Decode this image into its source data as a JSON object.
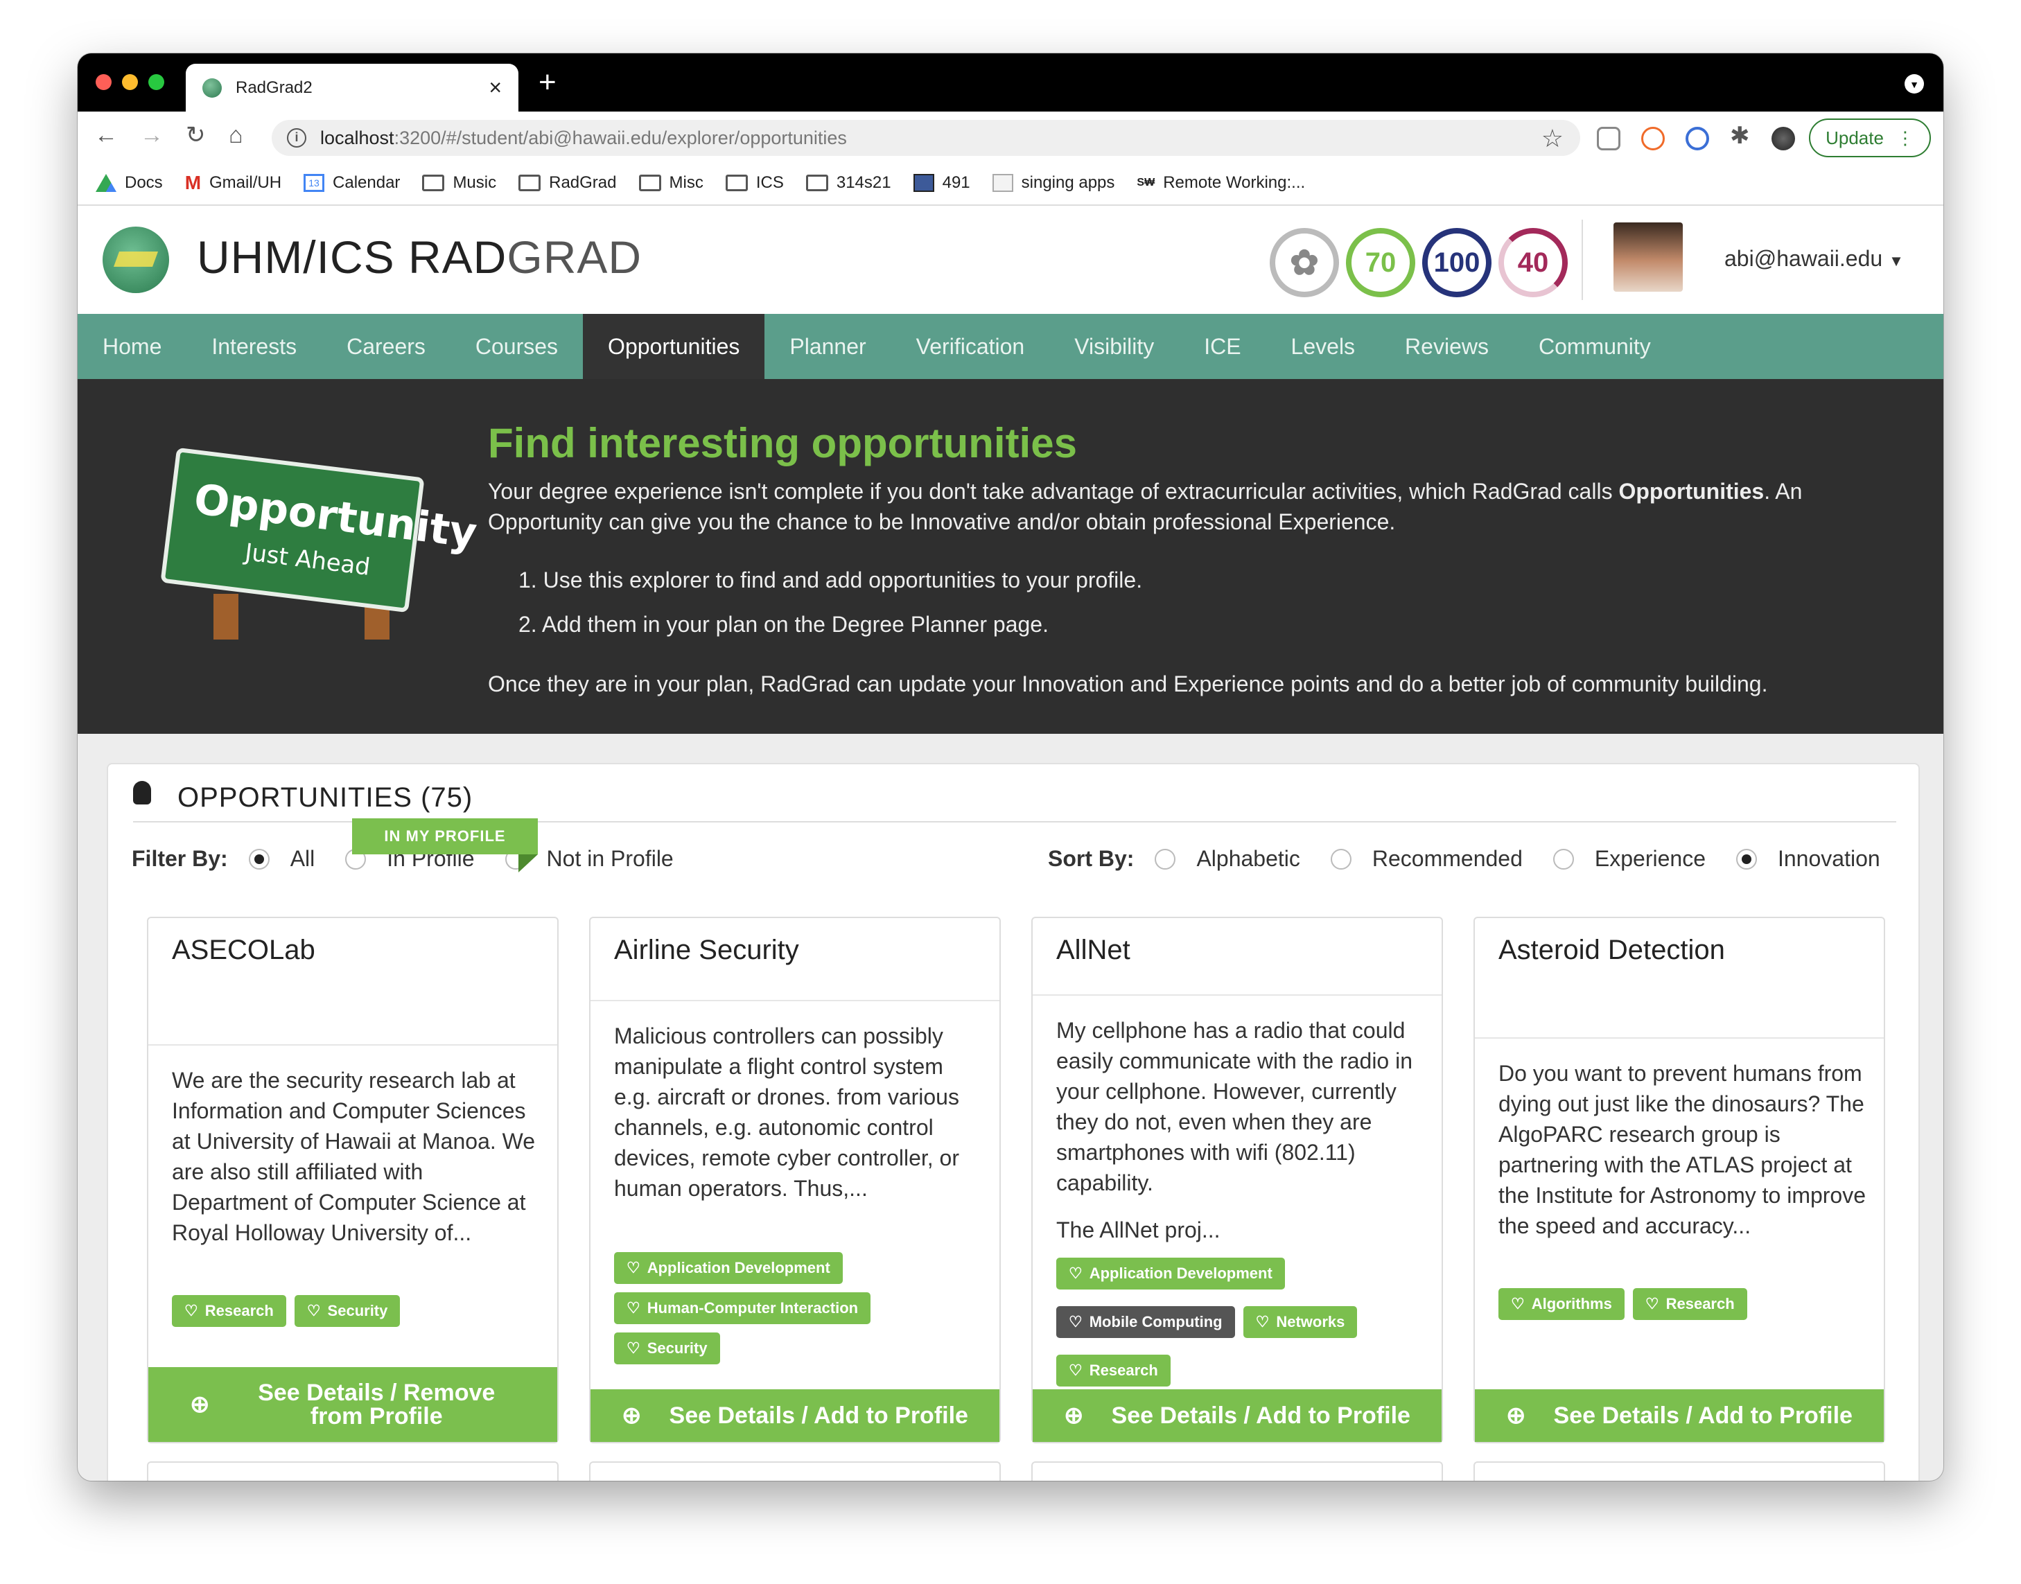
{
  "browser": {
    "tab_title": "RadGrad2",
    "url_host": "localhost",
    "url_rest": ":3200/#/student/abi@hawaii.edu/explorer/opportunities",
    "update_label": "Update",
    "bookmarks": [
      "Docs",
      "Gmail/UH",
      "Calendar",
      "Music",
      "RadGrad",
      "Misc",
      "ICS",
      "314s21",
      "491",
      "singing apps",
      "Remote Working:..."
    ]
  },
  "header": {
    "brand_bold": "UHM/ICS RAD",
    "brand_light": "GRAD",
    "scores": [
      "70",
      "100",
      "40"
    ],
    "score_colors": [
      "#7bc04a",
      "#26337a",
      "#a3295a"
    ],
    "user": "abi@hawaii.edu"
  },
  "nav": [
    "Home",
    "Interests",
    "Careers",
    "Courses",
    "Opportunities",
    "Planner",
    "Verification",
    "Visibility",
    "ICE",
    "Levels",
    "Reviews",
    "Community"
  ],
  "hero": {
    "sign_main": "Opportunity",
    "sign_sub": "Just Ahead",
    "title": "Find interesting opportunities",
    "intro_a": "Your degree experience isn't complete if you don't take advantage of extracurricular activities, which RadGrad calls ",
    "intro_bold": "Opportunities",
    "intro_b": ". An Opportunity can give you the chance to be Innovative and/or obtain professional Experience.",
    "steps": [
      "1. Use this explorer to find and add opportunities to your profile.",
      "2. Add them in your plan on the Degree Planner page."
    ],
    "outro": "Once they are in your plan, RadGrad can update your Innovation and Experience points and do a better job of community building."
  },
  "panel": {
    "title": "OPPORTUNITIES (75)",
    "filter_label": "Filter By:",
    "filters": [
      "All",
      "In Profile",
      "Not in Profile"
    ],
    "filter_selected": "All",
    "sort_label": "Sort By:",
    "sorts": [
      "Alphabetic",
      "Recommended",
      "Experience",
      "Innovation"
    ],
    "sort_selected": "Innovation"
  },
  "cards": [
    {
      "title": "ASECOLab",
      "ribbon": "IN MY PROFILE",
      "desc": "We are the security research lab at Information and Computer Sciences at University of Hawaii at Manoa. We are also still affiliated with Department of Computer Science at Royal Holloway University of...",
      "tags": [
        "Research",
        "Security"
      ],
      "button": "See Details / Remove from Profile"
    },
    {
      "title": "Airline Security",
      "desc": "Malicious controllers can possibly manipulate a flight control system e.g. aircraft or drones. from various channels, e.g. autonomic control devices, remote cyber controller, or human operators. Thus,...",
      "tags": [
        "Application Development",
        "Human-Computer Interaction",
        "Security"
      ],
      "button": "See Details / Add to Profile"
    },
    {
      "title": "AllNet",
      "desc": "My cellphone has a radio that could easily communicate with the radio in your cellphone. However, currently they do not, even when they are smartphones with wifi (802.11) capability.",
      "desc2": "The AllNet proj...",
      "tags": [
        "Application Development",
        "Mobile Computing",
        "Networks",
        "Research"
      ],
      "button": "See Details / Add to Profile"
    },
    {
      "title": "Asteroid Detection",
      "desc": "Do you want to prevent humans from dying out just like the dinosaurs? The AlgoPARC research group is partnering with the ATLAS project at the Institute for Astronomy to improve the speed and accuracy...",
      "tags": [
        "Algorithms",
        "Research"
      ],
      "button": "See Details / Add to Profile"
    }
  ]
}
